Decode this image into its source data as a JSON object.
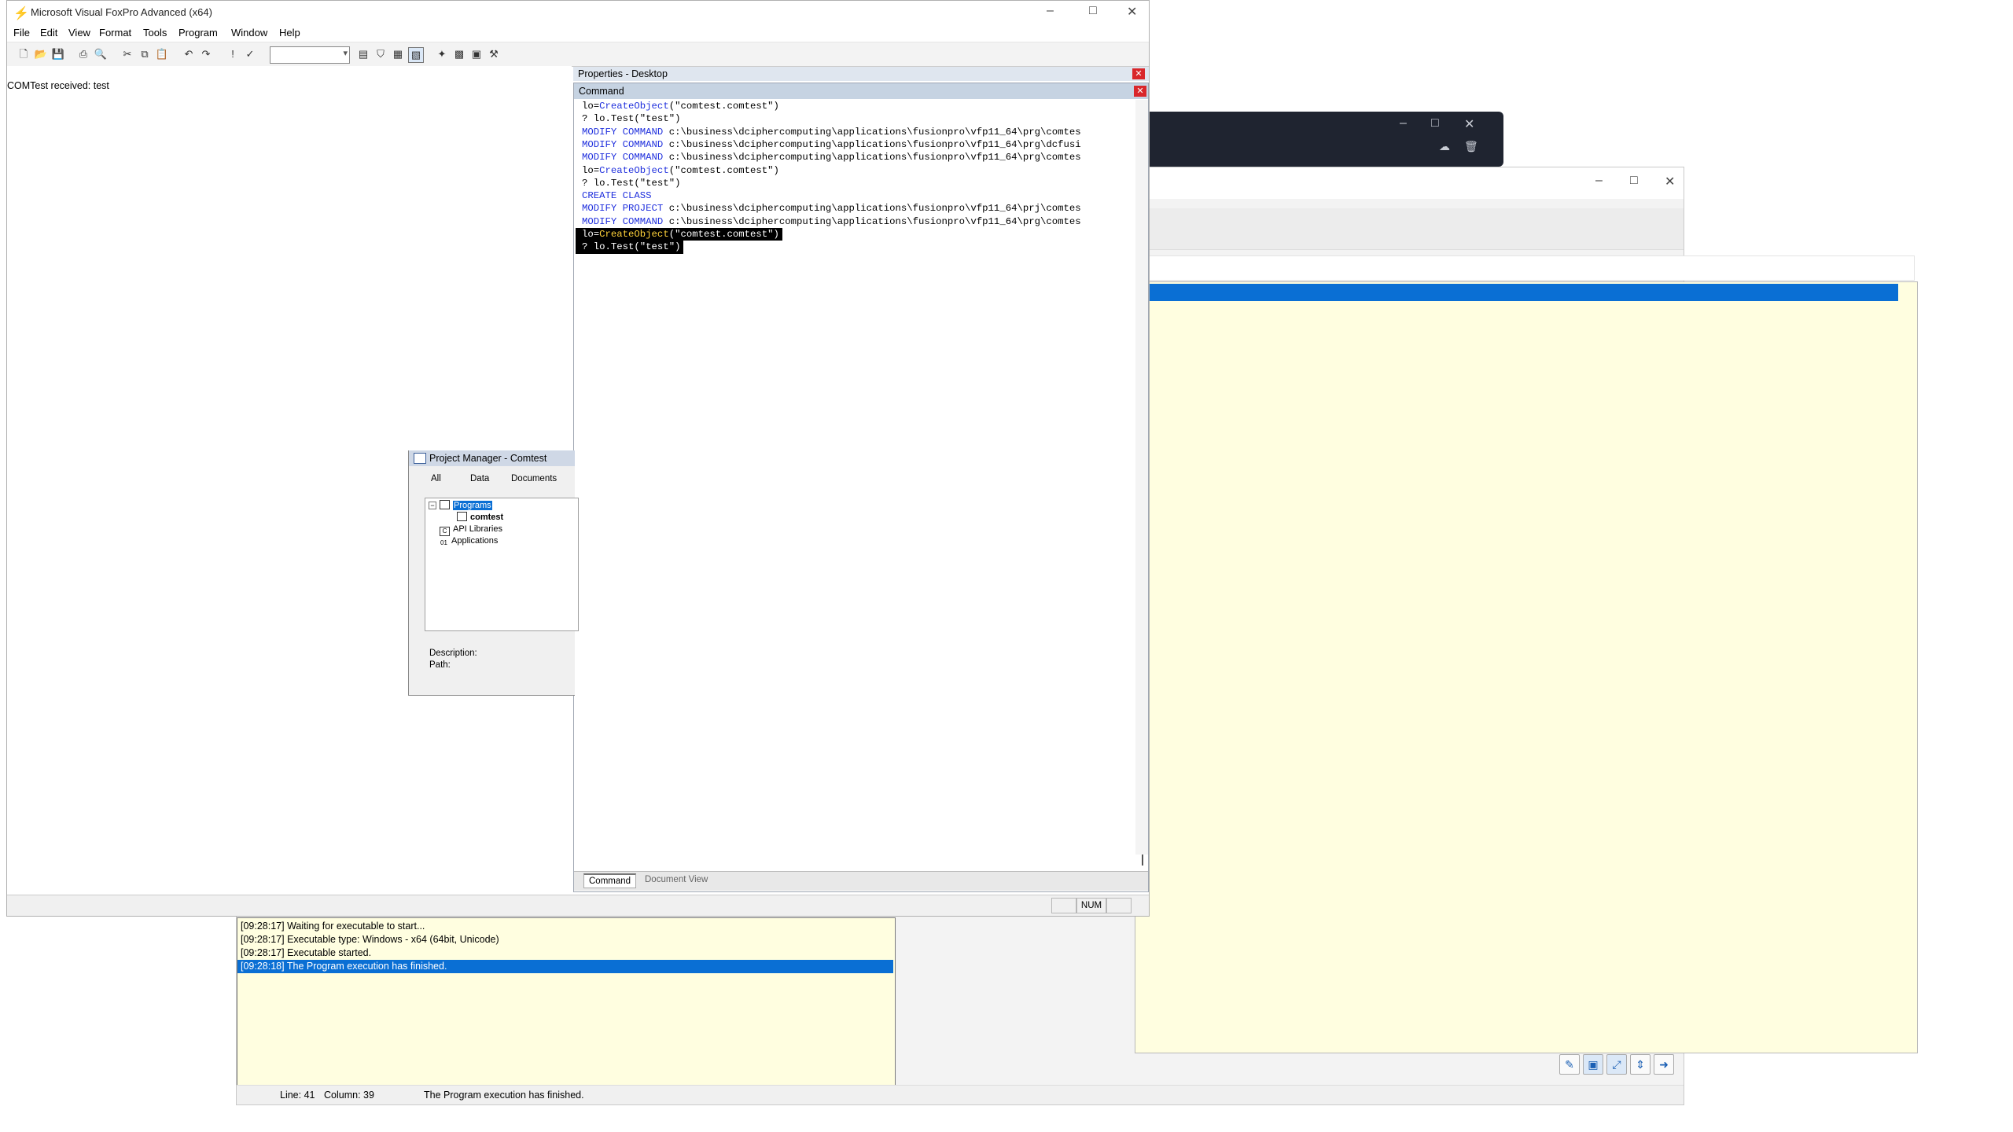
{
  "vfp": {
    "title": "Microsoft Visual FoxPro Advanced (x64)",
    "menu": [
      "File",
      "Edit",
      "View",
      "Format",
      "Tools",
      "Program",
      "Window",
      "Help"
    ],
    "output_text": "COMTest received: test",
    "status": {
      "num": "NUM"
    }
  },
  "properties_window": {
    "title": "Properties - Desktop"
  },
  "command_window": {
    "title": "Command",
    "lines": [
      "lo=CreateObject(\"comtest.comtest\")",
      "? lo.Test(\"test\")",
      "MODIFY COMMAND c:\\business\\dciphercomputing\\applications\\fusionpro\\vfp11_64\\prg\\comtes",
      "MODIFY COMMAND c:\\business\\dciphercomputing\\applications\\fusionpro\\vfp11_64\\prg\\dcfusi",
      "MODIFY COMMAND c:\\business\\dciphercomputing\\applications\\fusionpro\\vfp11_64\\prg\\comtes",
      "lo=CreateObject(\"comtest.comtest\")",
      "? lo.Test(\"test\")",
      "CREATE CLASS",
      "MODIFY PROJECT c:\\business\\dciphercomputing\\applications\\fusionpro\\vfp11_64\\prj\\comtes",
      "MODIFY COMMAND c:\\business\\dciphercomputing\\applications\\fusionpro\\vfp11_64\\prg\\comtes",
      "lo=CreateObject(\"comtest.comtest\")",
      "? lo.Test(\"test\")"
    ],
    "tabs": [
      "Command",
      "Document View"
    ]
  },
  "project_manager": {
    "title": "Project Manager - Comtest",
    "tabs": [
      "All",
      "Data",
      "Documents"
    ],
    "tree": [
      "Programs",
      "comtest",
      "API Libraries",
      "Applications"
    ],
    "description_label": "Description:",
    "path_label": "Path:"
  },
  "ide": {
    "log": [
      "[09:28:17] Waiting for executable to start...",
      "[09:28:17] Executable type: Windows - x64  (64bit, Unicode)",
      "[09:28:17] Executable started.",
      "[09:28:18] The Program execution has finished."
    ],
    "status": {
      "line": "Line: 41",
      "column": "Column: 39",
      "message": "The Program execution has finished."
    }
  },
  "colors": {
    "accent": "#0a6fd4",
    "editor_bg": "#fffee0",
    "keyword": "#1f2fdd"
  }
}
